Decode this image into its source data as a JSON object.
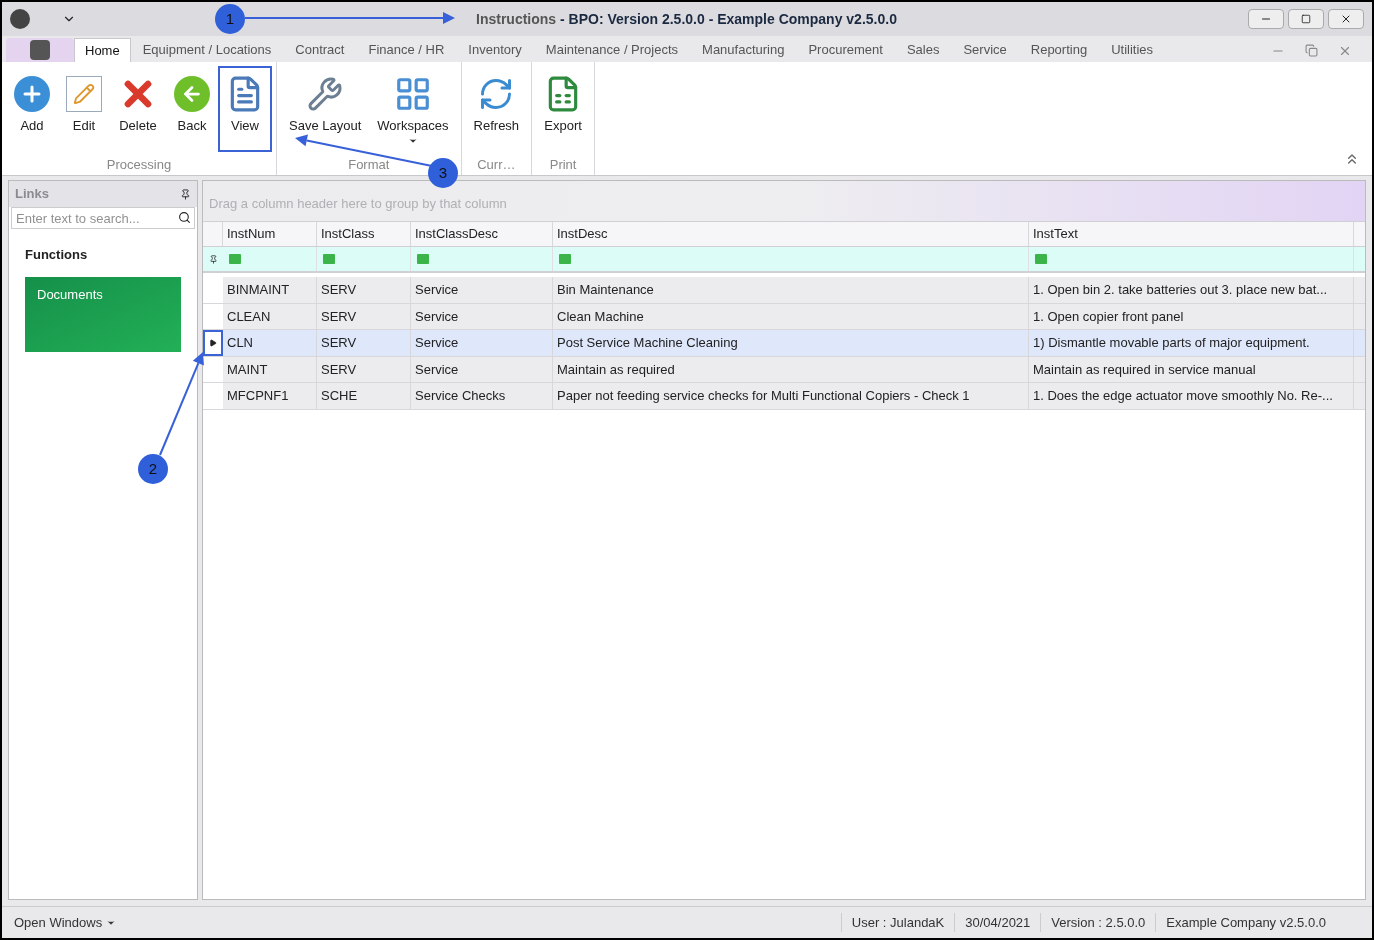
{
  "window": {
    "title_prefix": "Instructions",
    "title_rest": " - BPO: Version 2.5.0.0 - Example Company v2.5.0.0"
  },
  "menu_tabs": [
    {
      "label": "Home",
      "selected": true
    },
    {
      "label": "Equipment / Locations",
      "selected": false
    },
    {
      "label": "Contract",
      "selected": false
    },
    {
      "label": "Finance / HR",
      "selected": false
    },
    {
      "label": "Inventory",
      "selected": false
    },
    {
      "label": "Maintenance / Projects",
      "selected": false
    },
    {
      "label": "Manufacturing",
      "selected": false
    },
    {
      "label": "Procurement",
      "selected": false
    },
    {
      "label": "Sales",
      "selected": false
    },
    {
      "label": "Service",
      "selected": false
    },
    {
      "label": "Reporting",
      "selected": false
    },
    {
      "label": "Utilities",
      "selected": false
    }
  ],
  "ribbon_groups": [
    {
      "label": "Processing",
      "buttons": [
        {
          "label": "Add",
          "kind": "add",
          "highlighted": false
        },
        {
          "label": "Edit",
          "kind": "edit",
          "highlighted": false
        },
        {
          "label": "Delete",
          "kind": "delete",
          "highlighted": false
        },
        {
          "label": "Back",
          "kind": "back",
          "highlighted": false
        },
        {
          "label": "View",
          "kind": "view",
          "highlighted": true
        }
      ]
    },
    {
      "label": "Format",
      "buttons": [
        {
          "label": "Save Layout",
          "kind": "layout",
          "highlighted": false
        },
        {
          "label": "Workspaces",
          "kind": "workspaces",
          "highlighted": false,
          "dropdown": true
        }
      ]
    },
    {
      "label": "Curr…",
      "buttons": [
        {
          "label": "Refresh",
          "kind": "refresh",
          "highlighted": false
        }
      ]
    },
    {
      "label": "Print",
      "buttons": [
        {
          "label": "Export",
          "kind": "export",
          "highlighted": false
        }
      ]
    }
  ],
  "links_panel": {
    "title": "Links",
    "search_placeholder": "Enter text to search...",
    "section": "Functions",
    "tiles": [
      "Documents"
    ]
  },
  "grid": {
    "group_hint": "Drag a column header here to group by that column",
    "columns": [
      "InstNum",
      "InstClass",
      "InstClassDesc",
      "InstDesc",
      "InstText"
    ],
    "rows": [
      {
        "selected": false,
        "cells": [
          "BINMAINT",
          "SERV",
          "Service",
          "Bin Maintenance",
          "1. Open bin 2. take batteries out 3. place new bat..."
        ]
      },
      {
        "selected": false,
        "cells": [
          "CLEAN",
          "SERV",
          "Service",
          "Clean Machine",
          "1. Open copier front panel"
        ]
      },
      {
        "selected": true,
        "cells": [
          "CLN",
          "SERV",
          "Service",
          "Post Service Machine Cleaning",
          "1)  Dismantle movable parts of major equipment."
        ]
      },
      {
        "selected": false,
        "cells": [
          "MAINT",
          "SERV",
          "Service",
          "Maintain as required",
          "Maintain as required in service manual"
        ]
      },
      {
        "selected": false,
        "cells": [
          "MFCPNF1",
          "SCHE",
          "Service Checks",
          "Paper not feeding service checks for Multi Functional Copiers - Check 1",
          "1. Does the edge actuator move smoothly No. Re-..."
        ]
      }
    ]
  },
  "status_bar": {
    "open_windows": "Open Windows",
    "items": [
      "User : JulandaK",
      "30/04/2021",
      "Version : 2.5.0.0",
      "Example Company v2.5.0.0"
    ]
  },
  "annotations": [
    "1",
    "2",
    "3"
  ]
}
